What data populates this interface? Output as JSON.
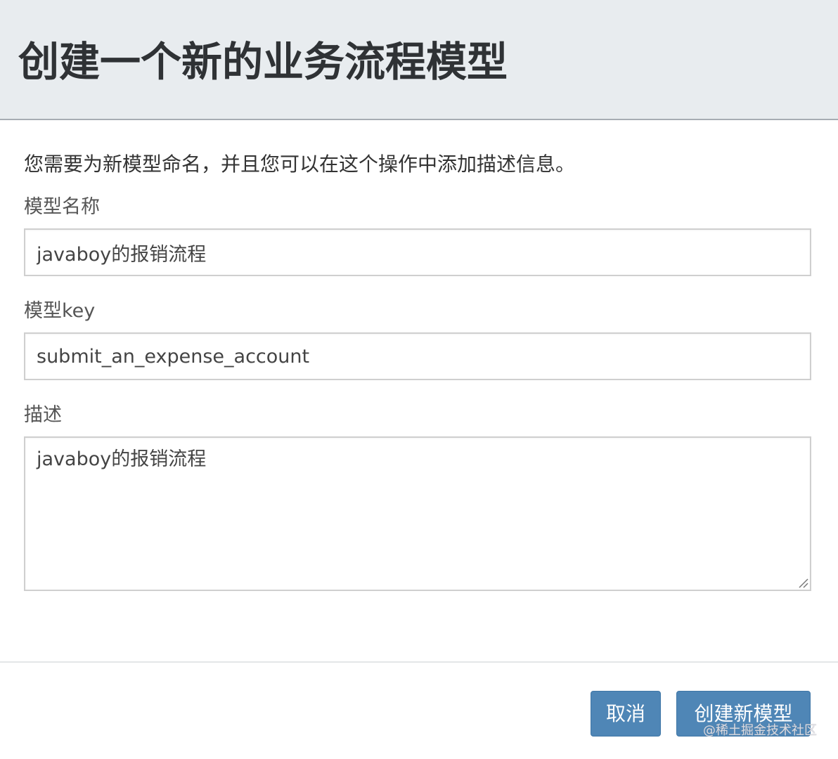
{
  "header": {
    "title": "创建一个新的业务流程模型"
  },
  "form": {
    "intro": "您需要为新模型命名，并且您可以在这个操作中添加描述信息。",
    "name_label": "模型名称",
    "name_value": "javaboy的报销流程",
    "key_label": "模型key",
    "key_value": "submit_an_expense_account",
    "description_label": "描述",
    "description_value": "javaboy的报销流程"
  },
  "footer": {
    "cancel_label": "取消",
    "create_label": "创建新模型"
  },
  "watermark": "@稀土掘金技术社区",
  "colors": {
    "header_bg": "#e8ecef",
    "button_bg": "#4f86b6"
  },
  "icons": {
    "textarea_resize": "resize-handle-icon"
  }
}
